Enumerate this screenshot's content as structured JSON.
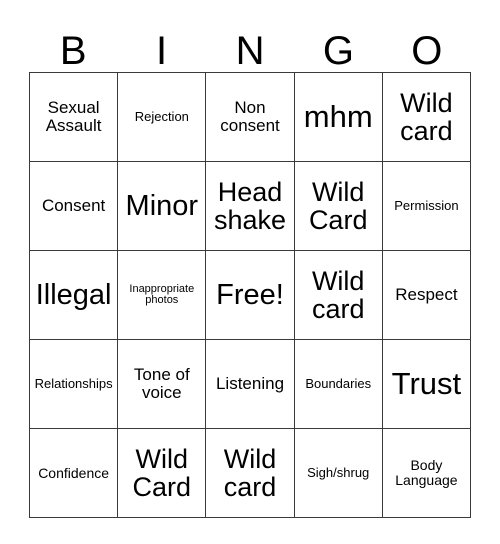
{
  "card": {
    "header_letters": [
      "B",
      "I",
      "N",
      "G",
      "O"
    ],
    "rows": [
      [
        {
          "text": "Sexual Assault",
          "size": "s-md"
        },
        {
          "text": "Rejection",
          "size": "s-xs"
        },
        {
          "text": "Non consent",
          "size": "s-md"
        },
        {
          "text": "mhm",
          "size": "s-xxl"
        },
        {
          "text": "Wild card",
          "size": "s-lg"
        }
      ],
      [
        {
          "text": "Consent",
          "size": "s-md"
        },
        {
          "text": "Minor",
          "size": "s-xl"
        },
        {
          "text": "Head shake",
          "size": "s-lg"
        },
        {
          "text": "Wild Card",
          "size": "s-lg"
        },
        {
          "text": "Permission",
          "size": "s-xs"
        }
      ],
      [
        {
          "text": "Illegal",
          "size": "s-xl"
        },
        {
          "text": "Inappropriate photos",
          "size": "s-xxs"
        },
        {
          "text": "Free!",
          "size": "s-xl"
        },
        {
          "text": "Wild card",
          "size": "s-lg"
        },
        {
          "text": "Respect",
          "size": "s-md"
        }
      ],
      [
        {
          "text": "Relationships",
          "size": "s-xs"
        },
        {
          "text": "Tone of voice",
          "size": "s-md"
        },
        {
          "text": "Listening",
          "size": "s-md"
        },
        {
          "text": "Boundaries",
          "size": "s-xs"
        },
        {
          "text": "Trust",
          "size": "s-xxl"
        }
      ],
      [
        {
          "text": "Confidence",
          "size": "s-sm"
        },
        {
          "text": "Wild Card",
          "size": "s-lg"
        },
        {
          "text": "Wild card",
          "size": "s-lg"
        },
        {
          "text": "Sigh/shrug",
          "size": "s-xs"
        },
        {
          "text": "Body Language",
          "size": "s-sm"
        }
      ]
    ],
    "colors": {
      "background": "#ffffff",
      "text": "#000000",
      "border": "#3a3a3a"
    }
  }
}
